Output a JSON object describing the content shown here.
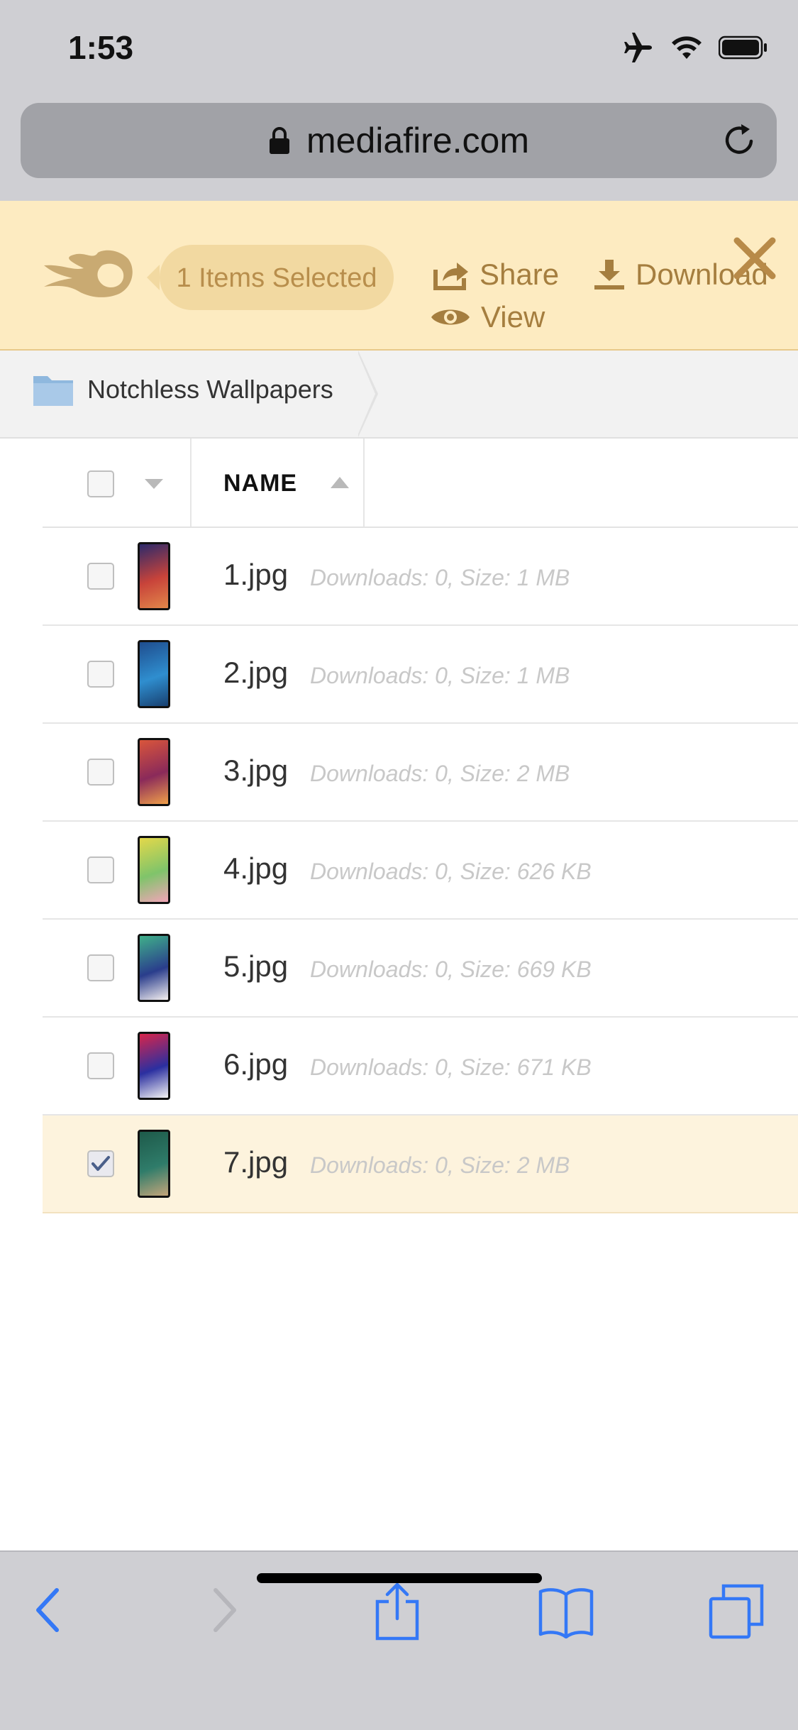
{
  "status_bar": {
    "time": "1:53"
  },
  "browser": {
    "url": "mediafire.com"
  },
  "selection_bar": {
    "selected_label": "1 Items Selected",
    "share_label": "Share",
    "download_label": "Download",
    "view_label": "View"
  },
  "breadcrumb": {
    "folder_name": "Notchless Wallpapers"
  },
  "table": {
    "name_header": "NAME",
    "rows": [
      {
        "name": "1.jpg",
        "meta": "Downloads: 0, Size: 1 MB",
        "checked": false,
        "thumb_colors": [
          "#2d2a6b",
          "#c8433a",
          "#e2874a"
        ]
      },
      {
        "name": "2.jpg",
        "meta": "Downloads: 0, Size: 1 MB",
        "checked": false,
        "thumb_colors": [
          "#1f4d8e",
          "#2f8ecf",
          "#184070"
        ]
      },
      {
        "name": "3.jpg",
        "meta": "Downloads: 0, Size: 2 MB",
        "checked": false,
        "thumb_colors": [
          "#d9553b",
          "#8a2a5a",
          "#f0a04a"
        ]
      },
      {
        "name": "4.jpg",
        "meta": "Downloads: 0, Size: 626 KB",
        "checked": false,
        "thumb_colors": [
          "#e3d84a",
          "#7fc46a",
          "#f2a5b8"
        ]
      },
      {
        "name": "5.jpg",
        "meta": "Downloads: 0, Size: 669 KB",
        "checked": false,
        "thumb_colors": [
          "#3fb08a",
          "#2a3d8c",
          "#f5f0f0"
        ]
      },
      {
        "name": "6.jpg",
        "meta": "Downloads: 0, Size: 671 KB",
        "checked": false,
        "thumb_colors": [
          "#d8254b",
          "#2b2fa0",
          "#f4f4f4"
        ]
      },
      {
        "name": "7.jpg",
        "meta": "Downloads: 0, Size: 2 MB",
        "checked": true,
        "thumb_colors": [
          "#1e5a4a",
          "#2f7c6a",
          "#c4a57a"
        ]
      }
    ]
  },
  "colors": {
    "toolbar_bg": "#fdebc1",
    "accent": "#a57e3f",
    "ios_blue": "#3478f6"
  }
}
